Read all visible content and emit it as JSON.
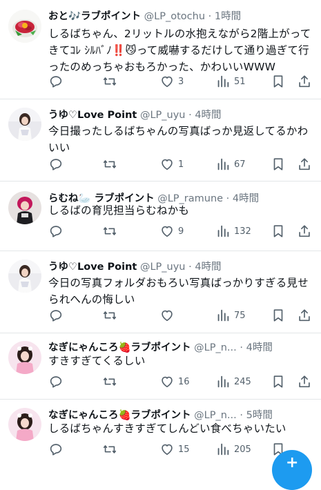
{
  "tweets": [
    {
      "name": "おと🎶ラブポイント",
      "handle": "@LP_otochu · 1時間",
      "text": "しるばちゃん、2リットルの水抱えながら2階上がってきてｺﾚ ｼﾙﾊﾞﾉ‼️😼って威嚇するだけして通り過ぎて行ったのめっちゃおもろかった、かわいいWWW",
      "replies": "",
      "retweets": "",
      "likes": "3",
      "views": "51"
    },
    {
      "name": "うゆ♡Love Point",
      "handle": "@LP_uyu · 4時間",
      "text": "今日撮ったしるばちゃんの写真ばっか見返してるかわいい",
      "replies": "",
      "retweets": "",
      "likes": "1",
      "views": "67"
    },
    {
      "name": "らむね🦢 ラブポイント",
      "handle": "@LP_ramune · 4時間",
      "text": "しるばの育児担当らむねかも",
      "replies": "",
      "retweets": "",
      "likes": "9",
      "views": "132"
    },
    {
      "name": "うゆ♡Love Point",
      "handle": "@LP_uyu · 4時間",
      "text": "今日の写真フォルダおもろい写真ばっかりすぎる見せられへんの悔しい",
      "replies": "",
      "retweets": "",
      "likes": "",
      "views": "75"
    },
    {
      "name": "なぎにゃんころ🍓ラブポイント",
      "handle": "@LP_n... · 4時間",
      "text": "すきすぎてくるしい",
      "replies": "",
      "retweets": "",
      "likes": "16",
      "views": "245"
    },
    {
      "name": "なぎにゃんころ🍓ラブポイント",
      "handle": "@LP_n... · 5時間",
      "text": "しるばちゃんすきすぎてしんどい食べちゃいたい",
      "replies": "",
      "retweets": "",
      "likes": "15",
      "views": "205"
    }
  ],
  "fab": {
    "label": "+"
  },
  "colors": {
    "accent": "#1d9bf0",
    "text": "#0f1419",
    "muted": "#53606b"
  }
}
